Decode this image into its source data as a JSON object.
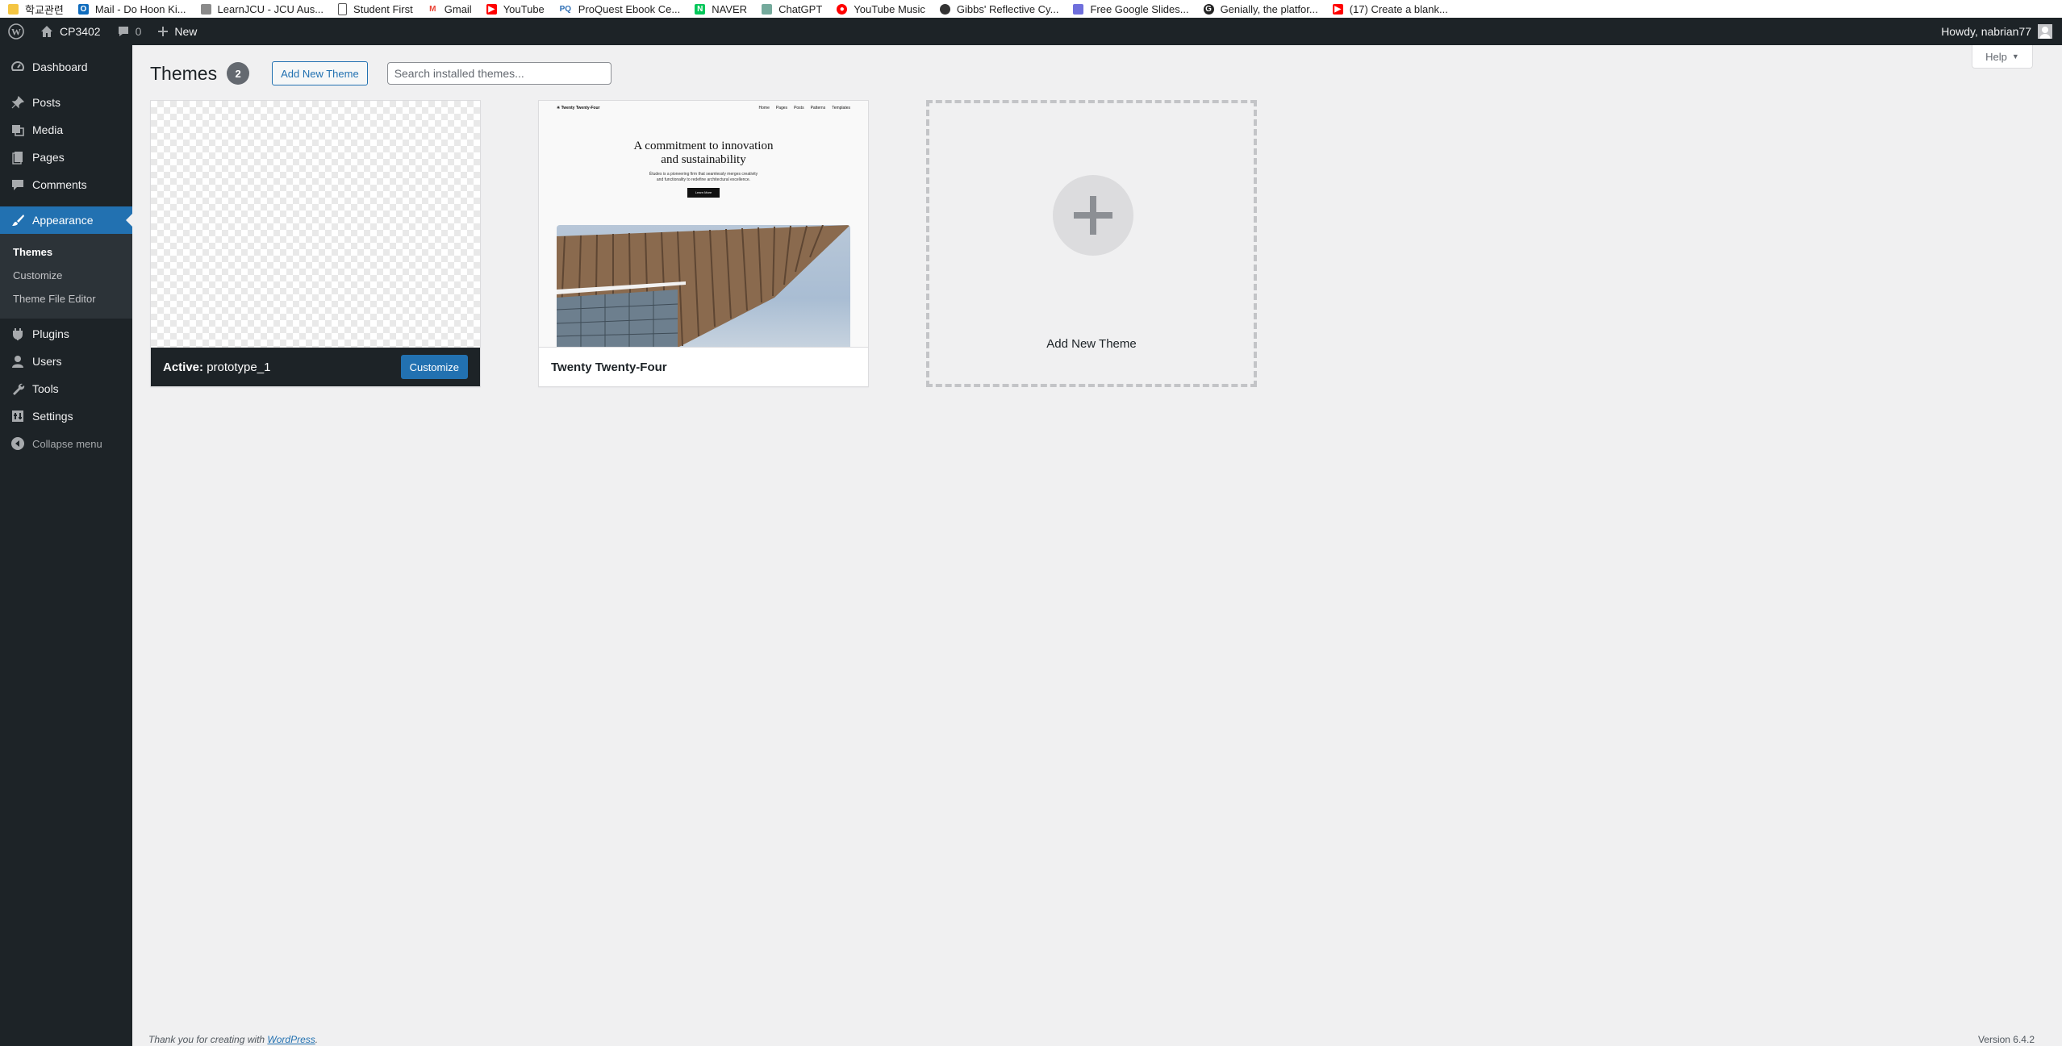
{
  "bookmarks": [
    {
      "label": "학교관련",
      "color": "#f4c542"
    },
    {
      "label": "Mail - Do Hoon Ki...",
      "color": "#0f6cbd"
    },
    {
      "label": "LearnJCU - JCU Aus...",
      "color": "#8a8a8a"
    },
    {
      "label": "Student First",
      "color": "#ffffff"
    },
    {
      "label": "Gmail",
      "color": "#ea4335"
    },
    {
      "label": "YouTube",
      "color": "#ff0000"
    },
    {
      "label": "ProQuest Ebook Ce...",
      "color": "#2f6fb5"
    },
    {
      "label": "NAVER",
      "color": "#03c75a"
    },
    {
      "label": "ChatGPT",
      "color": "#74aa9c"
    },
    {
      "label": "YouTube Music",
      "color": "#ff0000"
    },
    {
      "label": "Gibbs' Reflective Cy...",
      "color": "#333333"
    },
    {
      "label": "Free Google Slides...",
      "color": "#6f6fdc"
    },
    {
      "label": "Genially, the platfor...",
      "color": "#222222"
    },
    {
      "label": "(17) Create a blank...",
      "color": "#ff0000"
    }
  ],
  "adminbar": {
    "site_name": "CP3402",
    "comments_count": "0",
    "new_label": "New",
    "howdy": "Howdy, nabrian77"
  },
  "sidebar": {
    "items": [
      {
        "label": "Dashboard",
        "icon": "dashboard-icon"
      },
      {
        "label": "Posts",
        "icon": "pin-icon"
      },
      {
        "label": "Media",
        "icon": "media-icon"
      },
      {
        "label": "Pages",
        "icon": "pages-icon"
      },
      {
        "label": "Comments",
        "icon": "comment-icon"
      },
      {
        "label": "Appearance",
        "icon": "brush-icon"
      },
      {
        "label": "Plugins",
        "icon": "plugin-icon"
      },
      {
        "label": "Users",
        "icon": "user-icon"
      },
      {
        "label": "Tools",
        "icon": "wrench-icon"
      },
      {
        "label": "Settings",
        "icon": "settings-icon"
      }
    ],
    "submenu": [
      "Themes",
      "Customize",
      "Theme File Editor"
    ],
    "collapse": "Collapse menu"
  },
  "main": {
    "help": "Help",
    "title": "Themes",
    "count": "2",
    "add_new": "Add New Theme",
    "search_placeholder": "Search installed themes...",
    "themes": [
      {
        "active_label": "Active:",
        "name": "prototype_1",
        "customize": "Customize"
      },
      {
        "name": "Twenty Twenty-Four"
      }
    ],
    "preview": {
      "site_title": "Twenty Twenty-Four",
      "nav": [
        "Home",
        "Pages",
        "Posts",
        "Patterns",
        "Templates"
      ],
      "headline_1": "A commitment to innovation",
      "headline_2": "and sustainability",
      "para_1": "Études is a pioneering firm that seamlessly merges creativity",
      "para_2": "and functionality to redefine architectural excellence.",
      "button": "Learn More"
    },
    "add_card_label": "Add New Theme"
  },
  "footer": {
    "thanks": "Thank you for creating with ",
    "link": "WordPress",
    "period": ".",
    "version": "Version 6.4.2"
  }
}
